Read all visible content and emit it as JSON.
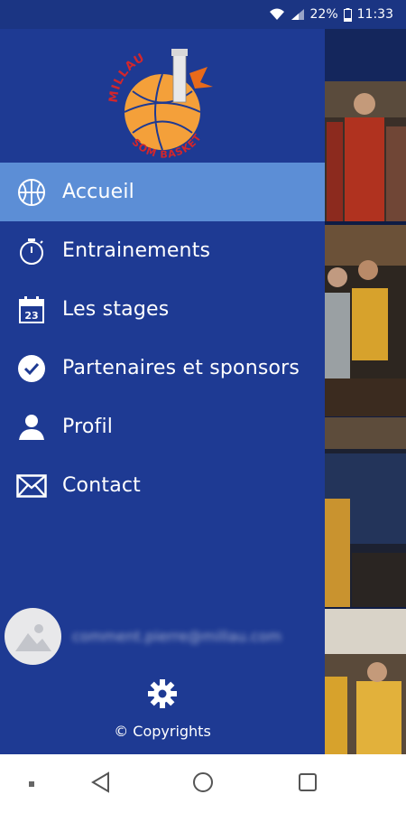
{
  "status_bar": {
    "battery": "22%",
    "time": "11:33"
  },
  "drawer": {
    "logo": {
      "text_top": "MILLAU",
      "text_bottom": "SOM BASKET"
    },
    "menu": [
      {
        "label": "Accueil",
        "icon": "basketball-icon",
        "active": true
      },
      {
        "label": "Entrainements",
        "icon": "stopwatch-icon",
        "active": false
      },
      {
        "label": "Les stages",
        "icon": "calendar-icon",
        "active": false
      },
      {
        "label": "Partenaires et sponsors",
        "icon": "check-circle-icon",
        "active": false
      },
      {
        "label": "Profil",
        "icon": "person-icon",
        "active": false
      },
      {
        "label": "Contact",
        "icon": "envelope-icon",
        "active": false
      }
    ],
    "calendar_day": "23",
    "user": {
      "email": "comment.pierre@millau.com"
    },
    "copyright": "© Copyrights"
  },
  "colors": {
    "drawer_bg": "#1e3a93",
    "active_item": "#5c8ed6",
    "logo_orange": "#f4a03a",
    "logo_red": "#d3262b"
  }
}
